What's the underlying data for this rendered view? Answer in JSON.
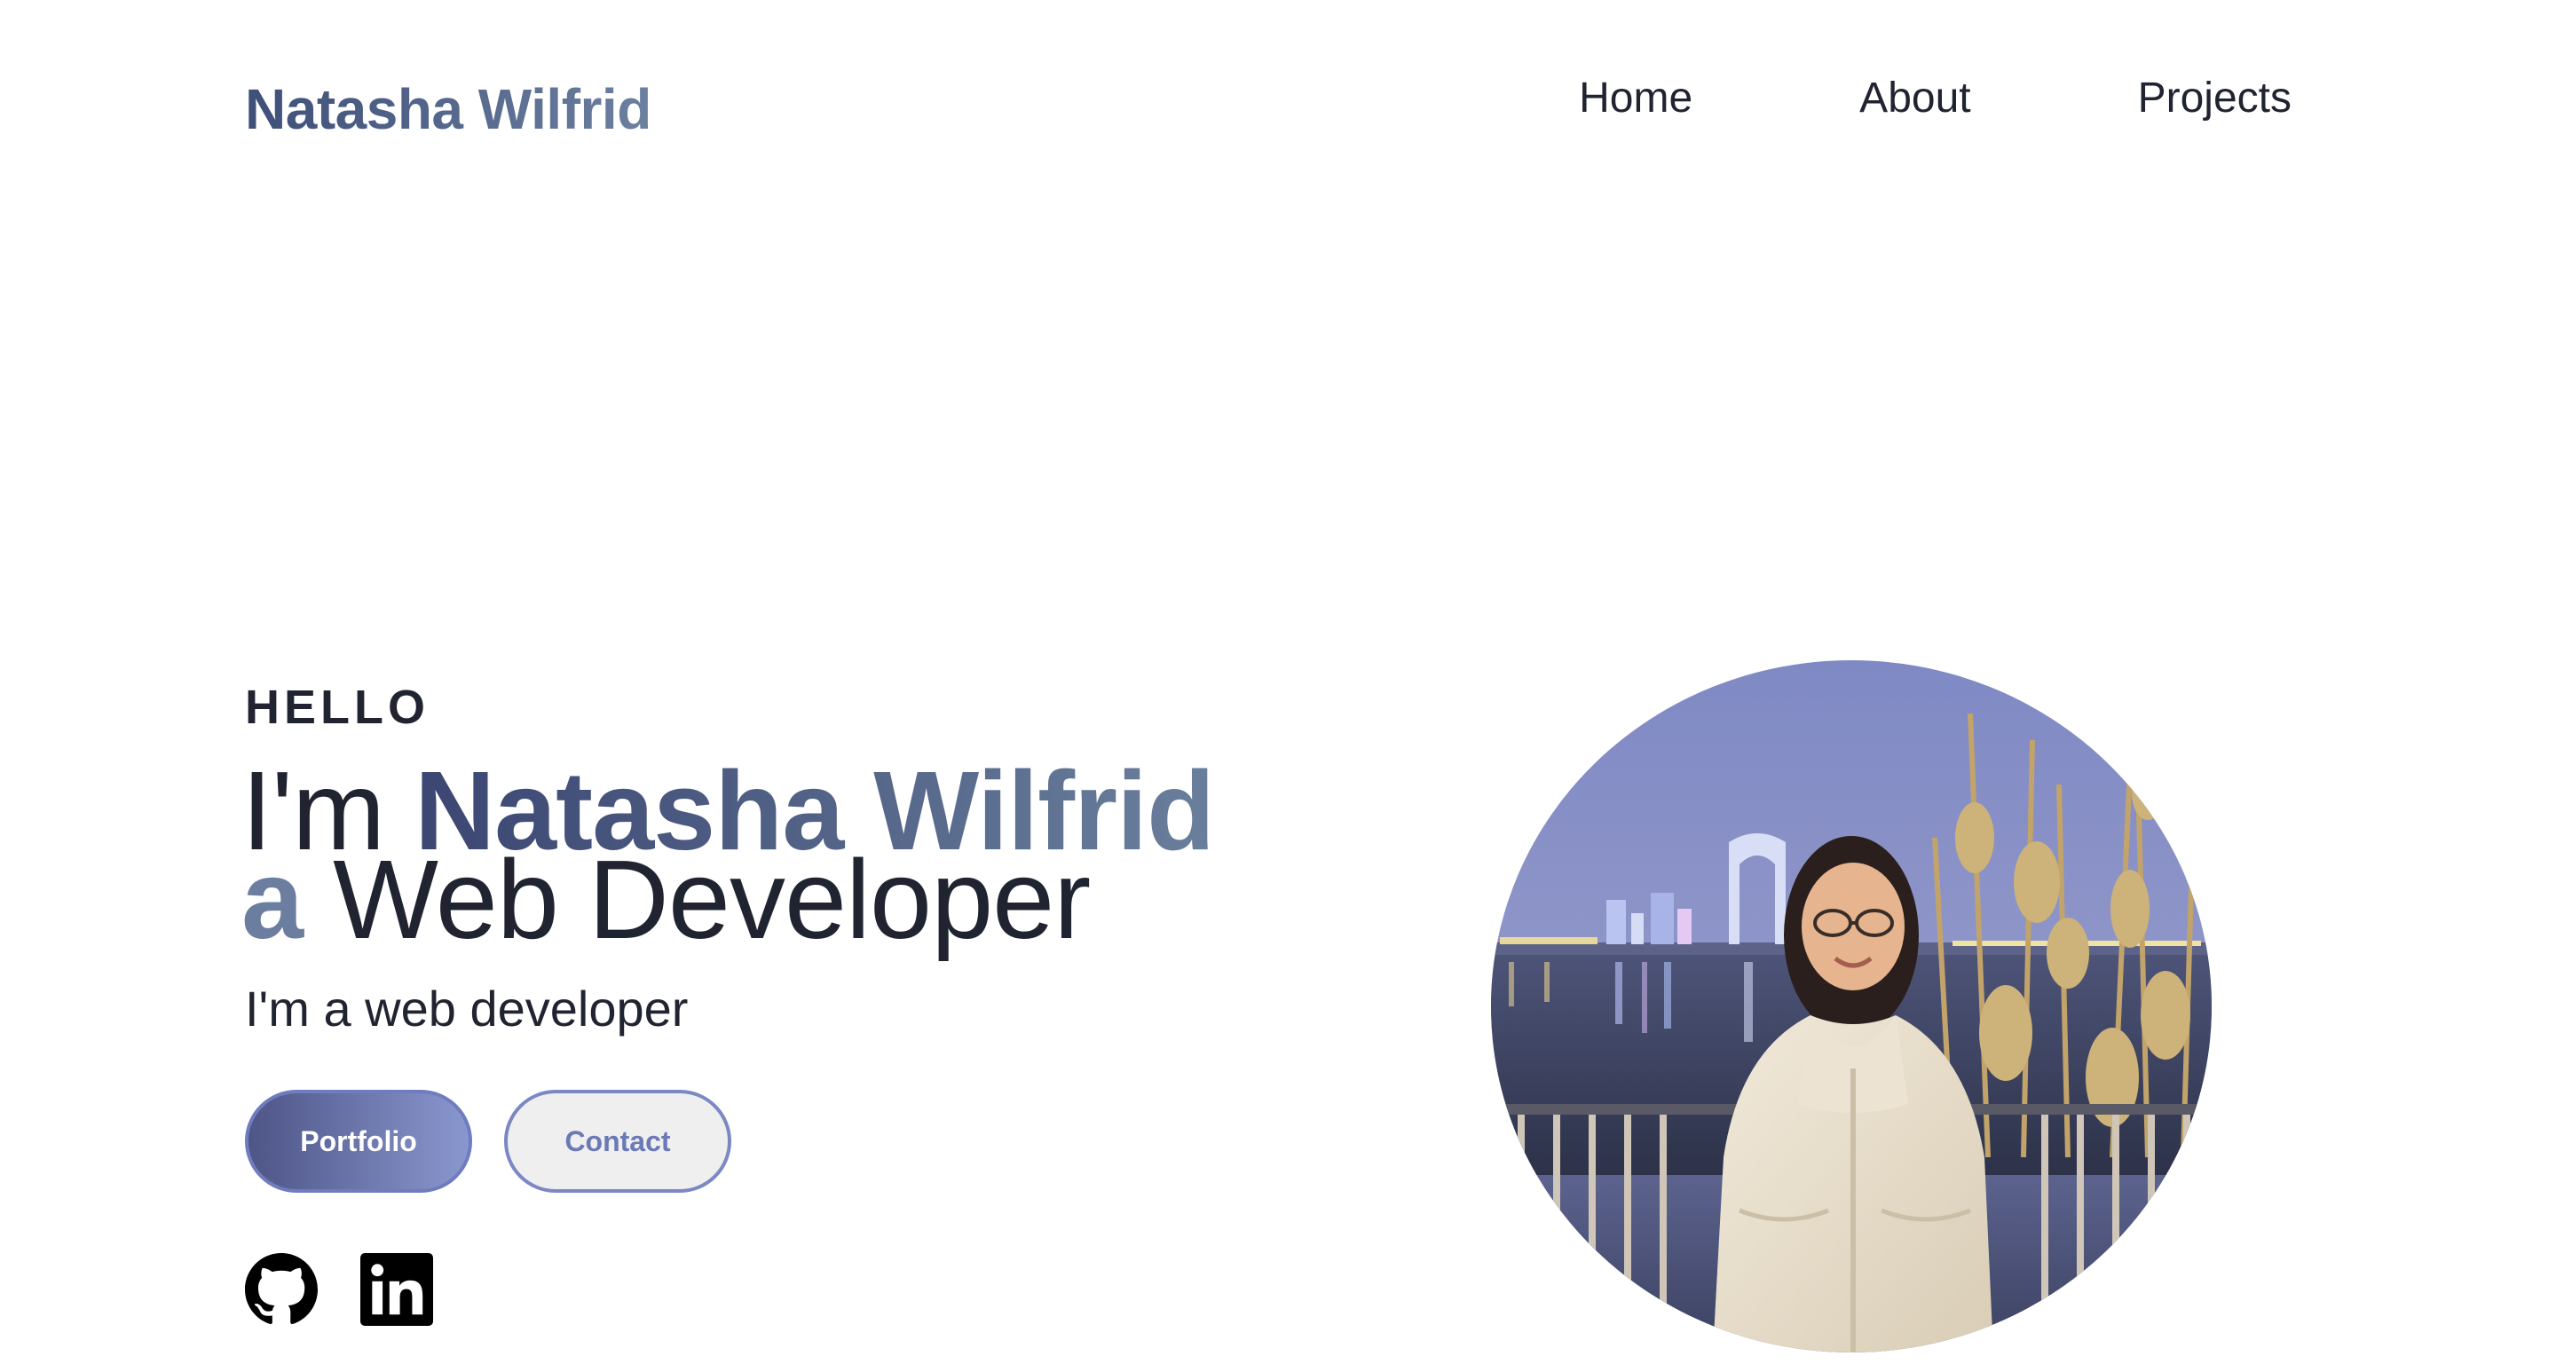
{
  "header": {
    "brand": "Natasha Wilfrid",
    "nav": [
      "Home",
      "About",
      "Projects"
    ]
  },
  "hero": {
    "greeting": "HELLO",
    "headline_prefix": "I'm",
    "headline_name": "Natasha Wilfrid",
    "headline_a": "a",
    "headline_role": "Web Developer",
    "subtitle": "I'm a web developer",
    "buttons": {
      "portfolio": "Portfolio",
      "contact": "Contact"
    }
  },
  "social": {
    "icons": [
      "github-icon",
      "linkedin-icon"
    ]
  },
  "colors": {
    "brand_gradient_start": "#3f4f78",
    "brand_gradient_end": "#6c80a0",
    "button_gradient_start": "#4e5587",
    "button_gradient_end": "#8a97cf",
    "contact_text": "#6b79b6",
    "text": "#1f2430"
  }
}
